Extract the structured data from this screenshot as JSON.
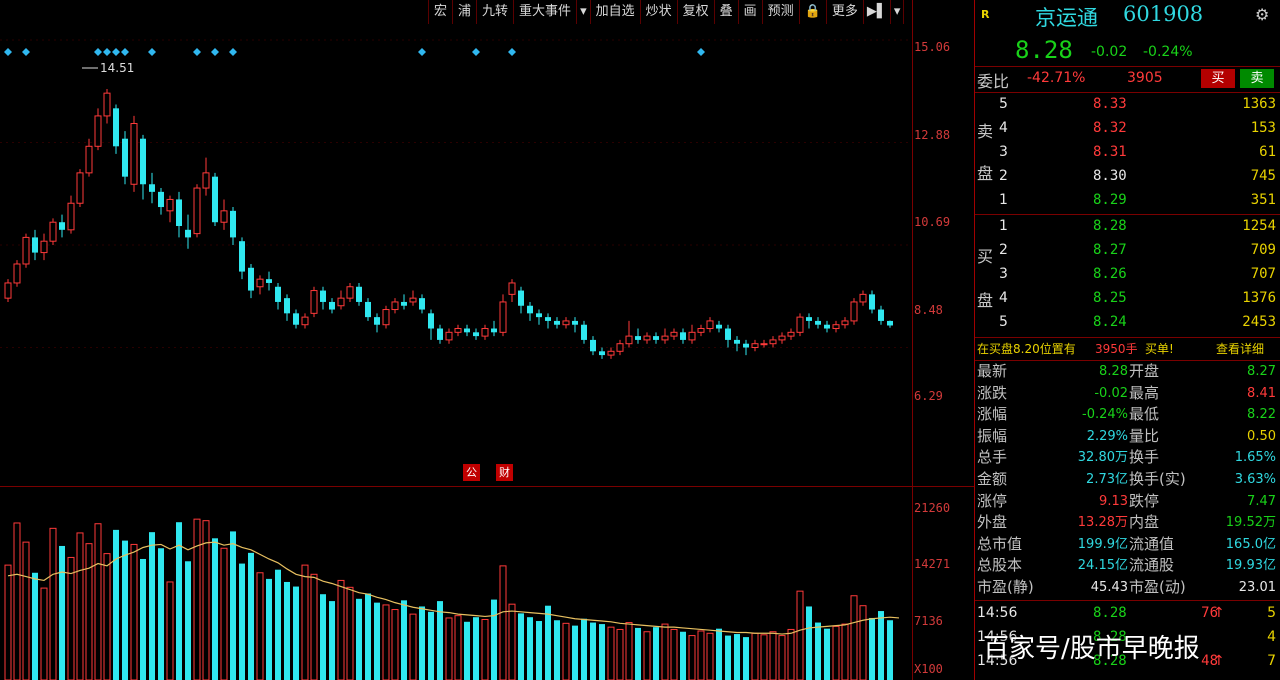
{
  "toolbar": {
    "items": [
      "宏",
      "浦",
      "九转",
      "重大事件",
      "▾",
      "加自选",
      "炒状",
      "复权",
      "叠",
      "画",
      "预测",
      "🔒",
      "更多",
      "▶▌",
      "▾"
    ]
  },
  "price_axis": [
    "15.06",
    "12.88",
    "10.69",
    "8.48",
    "6.29"
  ],
  "volume_axis": [
    "21260",
    "14271",
    "7136",
    "X100"
  ],
  "chart_annotations": {
    "high_label": "14.51",
    "marker_1": "公",
    "marker_2": "财"
  },
  "chart_data": {
    "type": "candlestick",
    "price_ylim": [
      5.0,
      15.8
    ],
    "volume_ylim": [
      0,
      23500
    ],
    "high_marker": 14.51,
    "candles": [
      [
        9.0,
        9.4,
        9.5,
        8.9
      ],
      [
        9.4,
        9.9,
        10.0,
        9.3
      ],
      [
        9.9,
        10.6,
        10.7,
        9.8
      ],
      [
        10.6,
        10.2,
        10.8,
        10.0
      ],
      [
        10.2,
        10.5,
        10.7,
        10.0
      ],
      [
        10.5,
        11.0,
        11.1,
        10.4
      ],
      [
        11.0,
        10.8,
        11.2,
        10.6
      ],
      [
        10.8,
        11.5,
        11.7,
        10.7
      ],
      [
        11.5,
        12.3,
        12.4,
        11.4
      ],
      [
        12.3,
        13.0,
        13.2,
        12.2
      ],
      [
        13.0,
        13.8,
        14.0,
        12.9
      ],
      [
        13.8,
        14.4,
        14.51,
        13.6
      ],
      [
        14.0,
        13.0,
        14.1,
        12.8
      ],
      [
        13.2,
        12.2,
        13.4,
        12.0
      ],
      [
        12.0,
        13.6,
        13.8,
        11.8
      ],
      [
        13.2,
        12.0,
        13.3,
        11.6
      ],
      [
        12.0,
        11.8,
        12.3,
        11.5
      ],
      [
        11.8,
        11.4,
        11.9,
        11.2
      ],
      [
        11.3,
        11.6,
        11.7,
        11.0
      ],
      [
        11.6,
        10.9,
        11.8,
        10.6
      ],
      [
        10.8,
        10.6,
        11.2,
        10.3
      ],
      [
        10.7,
        11.9,
        12.0,
        10.6
      ],
      [
        11.9,
        12.3,
        12.7,
        11.7
      ],
      [
        12.2,
        11.0,
        12.3,
        10.9
      ],
      [
        11.0,
        11.3,
        11.6,
        10.8
      ],
      [
        11.3,
        10.6,
        11.4,
        10.4
      ],
      [
        10.5,
        9.7,
        10.6,
        9.5
      ],
      [
        9.8,
        9.2,
        9.9,
        9.0
      ],
      [
        9.3,
        9.5,
        9.6,
        9.1
      ],
      [
        9.5,
        9.4,
        9.7,
        9.2
      ],
      [
        9.3,
        8.9,
        9.4,
        8.7
      ],
      [
        9.0,
        8.6,
        9.1,
        8.4
      ],
      [
        8.6,
        8.3,
        8.7,
        8.2
      ],
      [
        8.3,
        8.5,
        8.6,
        8.2
      ],
      [
        8.6,
        9.2,
        9.3,
        8.5
      ],
      [
        9.2,
        8.9,
        9.3,
        8.7
      ],
      [
        8.9,
        8.7,
        9.0,
        8.6
      ],
      [
        8.8,
        9.0,
        9.2,
        8.7
      ],
      [
        9.0,
        9.3,
        9.4,
        8.9
      ],
      [
        9.3,
        8.9,
        9.4,
        8.8
      ],
      [
        8.9,
        8.5,
        9.0,
        8.4
      ],
      [
        8.5,
        8.3,
        8.6,
        8.1
      ],
      [
        8.3,
        8.7,
        8.8,
        8.2
      ],
      [
        8.7,
        8.9,
        9.0,
        8.6
      ],
      [
        8.9,
        8.8,
        9.1,
        8.7
      ],
      [
        8.9,
        9.0,
        9.2,
        8.8
      ],
      [
        9.0,
        8.7,
        9.1,
        8.6
      ],
      [
        8.6,
        8.2,
        8.7,
        7.9
      ],
      [
        8.2,
        7.9,
        8.3,
        7.8
      ],
      [
        7.9,
        8.1,
        8.2,
        7.8
      ],
      [
        8.1,
        8.2,
        8.3,
        8.0
      ],
      [
        8.2,
        8.1,
        8.3,
        8.0
      ],
      [
        8.1,
        8.0,
        8.2,
        7.9
      ],
      [
        8.0,
        8.2,
        8.3,
        7.9
      ],
      [
        8.2,
        8.1,
        8.4,
        8.0
      ],
      [
        8.1,
        8.9,
        9.1,
        8.0
      ],
      [
        9.1,
        9.4,
        9.5,
        8.9
      ],
      [
        9.2,
        8.8,
        9.3,
        8.6
      ],
      [
        8.8,
        8.6,
        8.9,
        8.4
      ],
      [
        8.6,
        8.5,
        8.7,
        8.3
      ],
      [
        8.5,
        8.4,
        8.6,
        8.2
      ],
      [
        8.4,
        8.3,
        8.5,
        8.2
      ],
      [
        8.3,
        8.4,
        8.5,
        8.2
      ],
      [
        8.4,
        8.3,
        8.5,
        8.1
      ],
      [
        8.3,
        7.9,
        8.4,
        7.8
      ],
      [
        7.9,
        7.6,
        8.0,
        7.5
      ],
      [
        7.6,
        7.5,
        7.7,
        7.4
      ],
      [
        7.5,
        7.6,
        7.7,
        7.4
      ],
      [
        7.6,
        7.8,
        7.9,
        7.5
      ],
      [
        7.8,
        8.0,
        8.4,
        7.7
      ],
      [
        8.0,
        7.9,
        8.2,
        7.8
      ],
      [
        7.9,
        8.0,
        8.1,
        7.8
      ],
      [
        8.0,
        7.9,
        8.1,
        7.8
      ],
      [
        7.9,
        8.0,
        8.2,
        7.8
      ],
      [
        8.0,
        8.1,
        8.2,
        7.9
      ],
      [
        8.1,
        7.9,
        8.2,
        7.8
      ],
      [
        7.9,
        8.1,
        8.3,
        7.8
      ],
      [
        8.1,
        8.2,
        8.3,
        8.0
      ],
      [
        8.2,
        8.4,
        8.5,
        8.1
      ],
      [
        8.3,
        8.2,
        8.4,
        8.1
      ],
      [
        8.2,
        7.9,
        8.3,
        7.7
      ],
      [
        7.9,
        7.8,
        8.0,
        7.6
      ],
      [
        7.8,
        7.7,
        7.9,
        7.5
      ],
      [
        7.7,
        7.8,
        7.9,
        7.6
      ],
      [
        7.8,
        7.8,
        7.9,
        7.7
      ],
      [
        7.8,
        7.9,
        8.0,
        7.7
      ],
      [
        7.9,
        8.0,
        8.1,
        7.8
      ],
      [
        8.0,
        8.1,
        8.2,
        7.9
      ],
      [
        8.1,
        8.5,
        8.6,
        8.0
      ],
      [
        8.5,
        8.4,
        8.6,
        8.2
      ],
      [
        8.4,
        8.3,
        8.5,
        8.2
      ],
      [
        8.3,
        8.2,
        8.4,
        8.1
      ],
      [
        8.2,
        8.3,
        8.4,
        8.1
      ],
      [
        8.3,
        8.4,
        8.5,
        8.2
      ],
      [
        8.4,
        8.9,
        9.0,
        8.3
      ],
      [
        8.9,
        9.1,
        9.2,
        8.8
      ],
      [
        9.1,
        8.7,
        9.2,
        8.6
      ],
      [
        8.7,
        8.4,
        8.8,
        8.3
      ],
      [
        8.4,
        8.28,
        8.41,
        8.22
      ]
    ],
    "volumes": [
      15000,
      20500,
      18000,
      14000,
      12000,
      19800,
      17500,
      16000,
      19200,
      17800,
      20400,
      16500,
      19600,
      18200,
      17700,
      15800,
      19300,
      17200,
      12800,
      20600,
      15500,
      21000,
      20800,
      18500,
      17200,
      19400,
      15200,
      16600,
      14000,
      13200,
      14400,
      12800,
      12200,
      15000,
      13800,
      11200,
      10300,
      13000,
      12100,
      10600,
      11300,
      10100,
      9800,
      9200,
      10400,
      8600,
      9600,
      8900,
      10300,
      8100,
      8400,
      7600,
      8200,
      7900,
      10500,
      14900,
      9900,
      8700,
      8200,
      7700,
      9700,
      7800,
      7400,
      7100,
      8000,
      7500,
      7300,
      6900,
      6600,
      7500,
      6800,
      6300,
      6900,
      7300,
      6600,
      6300,
      5800,
      6400,
      6100,
      6700,
      5800,
      6000,
      5600,
      6100,
      5900,
      6300,
      5800,
      6600,
      11600,
      9600,
      7500,
      6700,
      7000,
      7300,
      11000,
      9700,
      8100,
      9000,
      7800,
      6100
    ],
    "volume_ma": [
      13600,
      13800,
      13500,
      13200,
      13000,
      13800,
      14100,
      13900,
      14300,
      14600,
      15200,
      14900,
      15800,
      16300,
      16700,
      17300,
      17600,
      17700,
      17100,
      17600,
      17000,
      17500,
      17900,
      18000,
      17600,
      17800,
      17300,
      17000,
      16400,
      15800,
      15300,
      14500,
      13800,
      13500,
      13400,
      12900,
      12600,
      12200,
      11800,
      11400,
      11200,
      10800,
      10500,
      10100,
      9800,
      9500,
      9300,
      9100,
      8900,
      8800,
      8600,
      8500,
      8400,
      8300,
      8400,
      8900,
      9000,
      8900,
      8800,
      8700,
      8600,
      8400,
      8200,
      8000,
      7900,
      7800,
      7700,
      7600,
      7400,
      7300,
      7200,
      7100,
      7000,
      6900,
      6900,
      6800,
      6700,
      6600,
      6500,
      6400,
      6300,
      6200,
      6200,
      6100,
      6100,
      6100,
      6000,
      6100,
      6500,
      6800,
      6900,
      7000,
      7100,
      7200,
      7500,
      7800,
      8000,
      8100,
      8200,
      8100
    ]
  },
  "quote": {
    "r_tag": "R",
    "name": "京运通",
    "code": "601908",
    "price": "8.28",
    "change": "-0.02",
    "change_pct": "-0.24%",
    "gear": "⚙"
  },
  "ratio": {
    "label": "委比",
    "value": "-42.71%",
    "diff": "3905",
    "buy_btn": "买",
    "sell_btn": "卖"
  },
  "sell_label": [
    "卖",
    "盘"
  ],
  "buy_label": [
    "买",
    "盘"
  ],
  "asks": [
    {
      "level": "5",
      "price": "8.33",
      "vol": "1363"
    },
    {
      "level": "4",
      "price": "8.32",
      "vol": "153"
    },
    {
      "level": "3",
      "price": "8.31",
      "vol": "61"
    },
    {
      "level": "2",
      "price": "8.30",
      "vol": "745"
    },
    {
      "level": "1",
      "price": "8.29",
      "vol": "351"
    }
  ],
  "bids": [
    {
      "level": "1",
      "price": "8.28",
      "vol": "1254"
    },
    {
      "level": "2",
      "price": "8.27",
      "vol": "709"
    },
    {
      "level": "3",
      "price": "8.26",
      "vol": "707"
    },
    {
      "level": "4",
      "price": "8.25",
      "vol": "1376"
    },
    {
      "level": "5",
      "price": "8.24",
      "vol": "2453"
    }
  ],
  "notice": {
    "text1": "在买盘8.20位置有",
    "amount": "3950手",
    "text2": "买单!",
    "link": "查看详细"
  },
  "stats": [
    {
      "l1": "最新",
      "v1": "8.28",
      "c1": "green",
      "l2": "开盘",
      "v2": "8.27",
      "c2": "green"
    },
    {
      "l1": "涨跌",
      "v1": "-0.02",
      "c1": "green",
      "l2": "最高",
      "v2": "8.41",
      "c2": "red"
    },
    {
      "l1": "涨幅",
      "v1": "-0.24%",
      "c1": "green",
      "l2": "最低",
      "v2": "8.22",
      "c2": "green"
    },
    {
      "l1": "振幅",
      "v1": "2.29%",
      "c1": "cyan",
      "l2": "量比",
      "v2": "0.50",
      "c2": "yellow"
    },
    {
      "l1": "总手",
      "v1": "32.80万",
      "c1": "cyan",
      "l2": "换手",
      "v2": "1.65%",
      "c2": "cyan"
    },
    {
      "l1": "金额",
      "v1": "2.73亿",
      "c1": "cyan",
      "l2": "换手(实)",
      "v2": "3.63%",
      "c2": "cyan"
    },
    {
      "l1": "涨停",
      "v1": "9.13",
      "c1": "red",
      "l2": "跌停",
      "v2": "7.47",
      "c2": "green"
    },
    {
      "l1": "外盘",
      "v1": "13.28万",
      "c1": "red",
      "l2": "内盘",
      "v2": "19.52万",
      "c2": "green"
    },
    {
      "l1": "总市值",
      "v1": "199.9亿",
      "c1": "cyan",
      "l2": "流通值",
      "v2": "165.0亿",
      "c2": "cyan"
    },
    {
      "l1": "总股本",
      "v1": "24.15亿",
      "c1": "cyan",
      "l2": "流通股",
      "v2": "19.93亿",
      "c2": "cyan"
    },
    {
      "l1": "市盈(静)",
      "v1": "45.43",
      "c1": "white",
      "l2": "市盈(动)",
      "v2": "23.01",
      "c2": "white"
    }
  ],
  "ticks": [
    {
      "time": "14:56",
      "price": "8.28",
      "vol": "76",
      "arrow": "↑",
      "n": "5"
    },
    {
      "time": "14:56",
      "price": "8.28",
      "vol": "",
      "arrow": "",
      "n": "4"
    },
    {
      "time": "14:56",
      "price": "8.28",
      "vol": "48",
      "arrow": "↑",
      "n": "7"
    }
  ],
  "watermark": "百家号/股市早晚报"
}
